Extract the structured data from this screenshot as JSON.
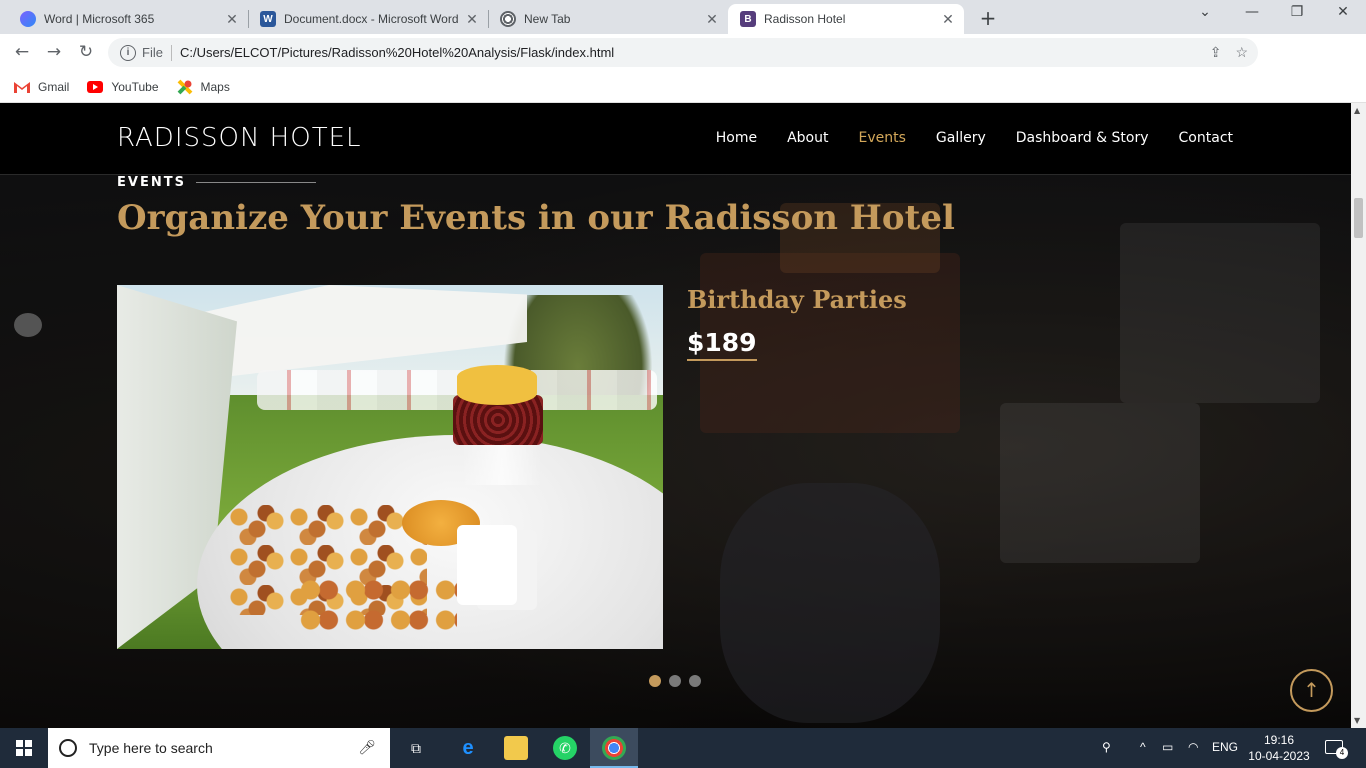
{
  "browser": {
    "tabs": [
      {
        "title": "Word | Microsoft 365",
        "icon": "microsoft365-icon",
        "active": false
      },
      {
        "title": "Document.docx - Microsoft Word",
        "icon": "word-icon",
        "active": false
      },
      {
        "title": "New Tab",
        "icon": "chrome-icon",
        "active": false
      },
      {
        "title": "Radisson Hotel",
        "icon": "bootstrap-icon",
        "active": true
      }
    ],
    "address": {
      "scheme_label": "File",
      "url": "C:/Users/ELCOT/Pictures/Radisson%20Hotel%20Analysis/Flask/index.html"
    },
    "bookmarks": [
      {
        "label": "Gmail",
        "icon": "gmail-icon"
      },
      {
        "label": "YouTube",
        "icon": "youtube-icon"
      },
      {
        "label": "Maps",
        "icon": "maps-icon"
      }
    ]
  },
  "site": {
    "brand": "RADISSON HOTEL",
    "nav": [
      {
        "label": "Home",
        "active": false
      },
      {
        "label": "About",
        "active": false
      },
      {
        "label": "Events",
        "active": true
      },
      {
        "label": "Gallery",
        "active": false
      },
      {
        "label": "Dashboard & Story",
        "active": false
      },
      {
        "label": "Contact",
        "active": false
      }
    ],
    "section": {
      "kicker": "EVENTS",
      "headline": "Organize Your Events in our Radisson Hotel"
    },
    "event": {
      "title": "Birthday Parties",
      "price": "$189"
    },
    "slider": {
      "count": 3,
      "active_index": 0
    },
    "colors": {
      "accent": "#c49a5c",
      "header_bg": "#000000"
    }
  },
  "taskbar": {
    "search_placeholder": "Type here to search",
    "language": "ENG",
    "time": "19:16",
    "date": "10-04-2023",
    "notification_count": "4"
  }
}
